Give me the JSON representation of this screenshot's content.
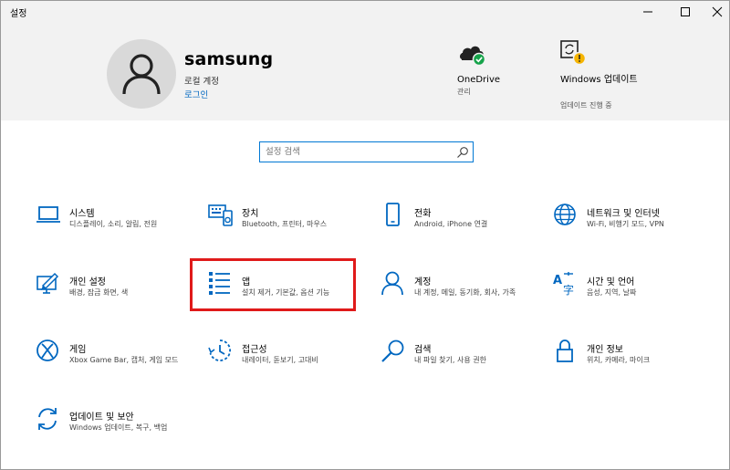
{
  "window": {
    "title": "설정"
  },
  "profile": {
    "name": "samsung",
    "account_type": "로컬 계정",
    "sign_in": "로그인"
  },
  "header_items": {
    "onedrive": {
      "title": "OneDrive",
      "sub": "관리"
    },
    "windows_update": {
      "title": "Windows 업데이트",
      "sub": "업데이트 진행 중"
    }
  },
  "search": {
    "placeholder": "설정 검색"
  },
  "tiles": [
    {
      "name": "시스템",
      "desc": "디스플레이, 소리, 알림, 전원",
      "icon": "laptop-icon"
    },
    {
      "name": "장치",
      "desc": "Bluetooth, 프린터, 마우스",
      "icon": "devices-icon"
    },
    {
      "name": "전화",
      "desc": "Android, iPhone 연결",
      "icon": "phone-icon"
    },
    {
      "name": "네트워크 및 인터넷",
      "desc": "Wi-Fi, 비행기 모드, VPN",
      "icon": "globe-icon"
    },
    {
      "name": "개인 설정",
      "desc": "배경, 잠금 화면, 색",
      "icon": "personalization-icon"
    },
    {
      "name": "앱",
      "desc": "설치 제거, 기본값, 옵션 기능",
      "icon": "apps-list-icon"
    },
    {
      "name": "계정",
      "desc": "내 계정, 메일, 동기화, 회사, 가족",
      "icon": "person-icon"
    },
    {
      "name": "시간 및 언어",
      "desc": "음성, 지역, 날짜",
      "icon": "language-icon"
    },
    {
      "name": "게임",
      "desc": "Xbox Game Bar, 캡처, 게임 모드",
      "icon": "xbox-icon"
    },
    {
      "name": "접근성",
      "desc": "내레이터, 돋보기, 고대비",
      "icon": "ease-of-access-icon"
    },
    {
      "name": "검색",
      "desc": "내 파일 찾기, 사용 권한",
      "icon": "search-icon"
    },
    {
      "name": "개인 정보",
      "desc": "위치, 카메라, 마이크",
      "icon": "lock-icon"
    },
    {
      "name": "업데이트 및 보안",
      "desc": "Windows 업데이트, 복구, 백업",
      "icon": "sync-icon"
    }
  ],
  "colors": {
    "accent": "#0067c0",
    "highlight": "#e01a1a",
    "header_bg": "#f2f2f2"
  }
}
